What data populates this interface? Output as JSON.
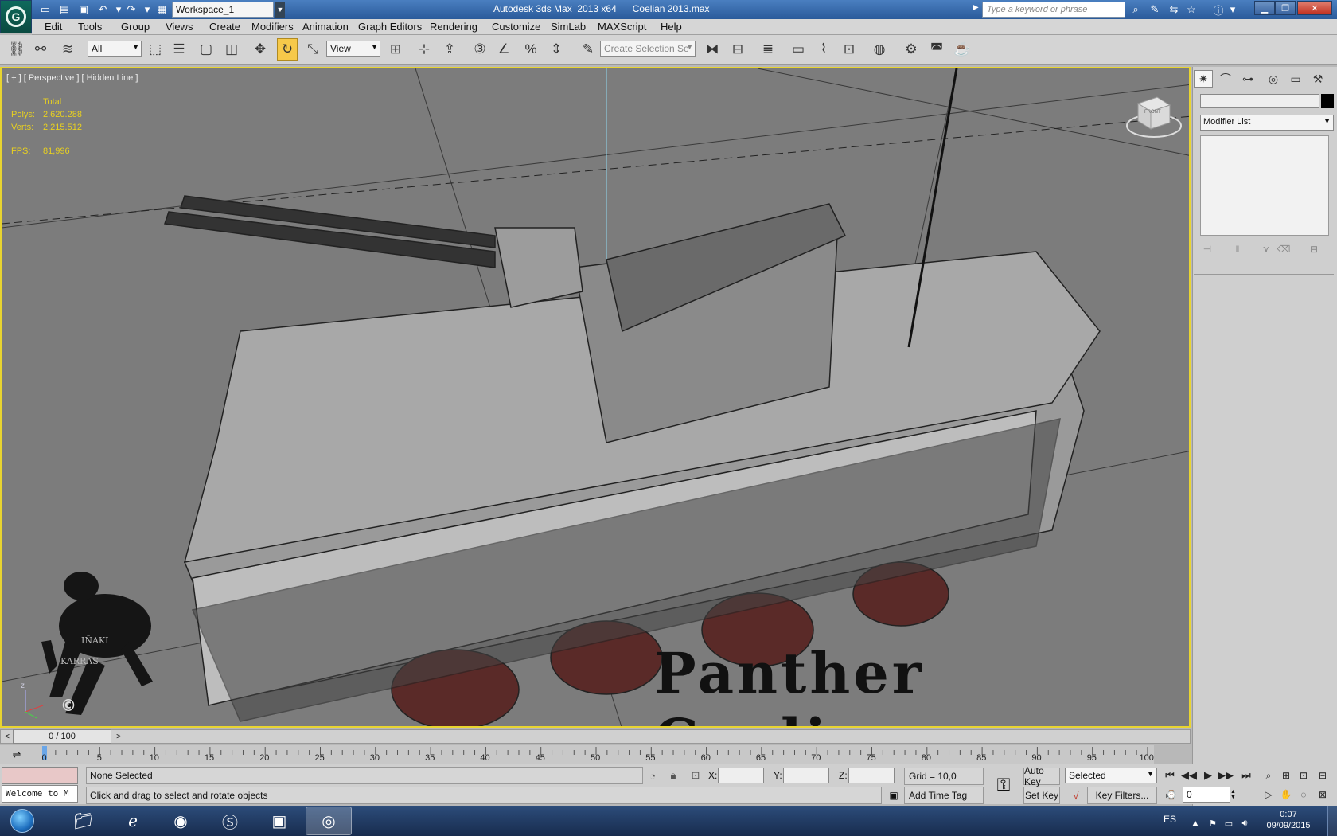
{
  "app": {
    "title": "Autodesk 3ds Max  2013 x64      Coelian 2013.max",
    "logo_letter": "G",
    "workspace": "Workspace_1",
    "search_placeholder": "Type a keyword or phrase"
  },
  "menu": [
    "Edit",
    "Tools",
    "Group",
    "Views",
    "Create",
    "Modifiers",
    "Animation",
    "Graph Editors",
    "Rendering",
    "Customize",
    "SimLab",
    "MAXScript",
    "Help"
  ],
  "toolbar": {
    "filter_value": "All",
    "refcoord_value": "View",
    "selection_set_placeholder": "Create Selection Se"
  },
  "viewport": {
    "label": "[ + ] [ Perspective ] [ Hidden Line ]",
    "stats": {
      "total_label": "Total",
      "polys_label": "Polys:",
      "polys_value": "2.620.288",
      "verts_label": "Verts:",
      "verts_value": "2.215.512",
      "fps_label": "FPS:",
      "fps_value": "81,996"
    },
    "overlay_title": "Panther  Coelian",
    "watermark_line1": "IÑAKI",
    "watermark_line2": "KARRAS",
    "watermark_copyright": "©",
    "viewcube_label": "FRONT"
  },
  "command_panel": {
    "modifier_list": "Modifier List"
  },
  "timeline": {
    "slider_text": "0 / 100",
    "tick_labels": [
      "0",
      "5",
      "10",
      "15",
      "20",
      "25",
      "30",
      "35",
      "40",
      "45",
      "50",
      "55",
      "60",
      "65",
      "70",
      "75",
      "80",
      "85",
      "90",
      "95",
      "100"
    ]
  },
  "status": {
    "maxscript_text": "Welcome to M",
    "selection": "None Selected",
    "prompt": "Click and drag to select and rotate objects",
    "x_label": "X:",
    "y_label": "Y:",
    "z_label": "Z:",
    "grid": "Grid = 10,0",
    "add_time_tag": "Add Time Tag",
    "auto_key": "Auto Key",
    "set_key": "Set Key",
    "selected_dropdown": "Selected",
    "key_filters": "Key Filters...",
    "current_frame": "0"
  },
  "taskbar": {
    "language": "ES",
    "time": "0:07",
    "date": "09/09/2015"
  },
  "colors": {
    "viewport_border": "#e8d430",
    "stats_text": "#e8d020",
    "titlebar": "#2a5a9a"
  }
}
